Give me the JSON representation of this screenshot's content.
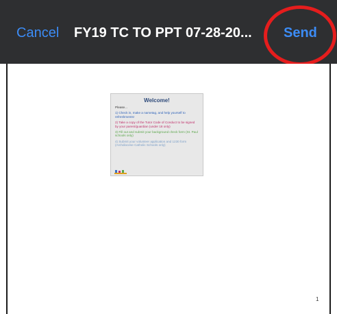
{
  "nav": {
    "cancel_label": "Cancel",
    "title": "FY19 TC TO PPT 07-28-20...",
    "send_label": "Send"
  },
  "colors": {
    "nav_background": "#2e2f31",
    "action_blue": "#3c8cf6",
    "highlight_red": "#e51d1d"
  },
  "document": {
    "page_number": "1",
    "slide": {
      "title": "Welcome!",
      "intro": "Please...",
      "items": [
        "1) Check in, make a nametag, and help yourself to refreshments!",
        "2) Take a copy of the Tutor Code of Conduct to be signed by your parent/guardian (under 18 only)",
        "3) Fill out and submit your background check form (St. Paul schools only)",
        "4) Submit your volunteer application and 1230 form (Archdiocese Catholic Schools only)"
      ]
    }
  }
}
